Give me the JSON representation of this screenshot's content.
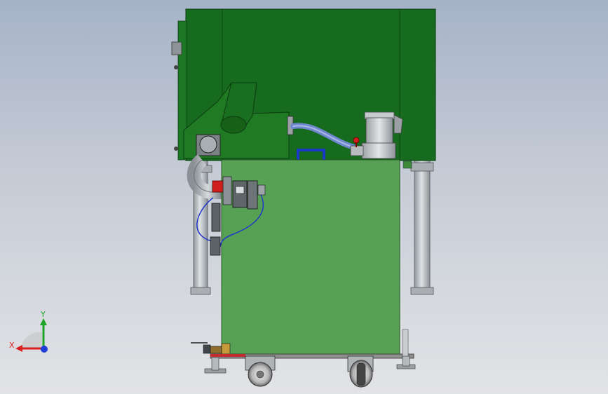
{
  "triad": {
    "x_label": "X",
    "y_label": "Y",
    "x_color": "#d81e1e",
    "y_color": "#1fa42a",
    "z_color": "#1f3fd8"
  },
  "colors": {
    "upper_housing": "#176b1e",
    "lower_cabinet": "#57a154",
    "hose": "#6f87cf",
    "pneumatic_line": "#2136c9",
    "metal": "#b9bec2",
    "valve_red": "#d01d1d"
  }
}
